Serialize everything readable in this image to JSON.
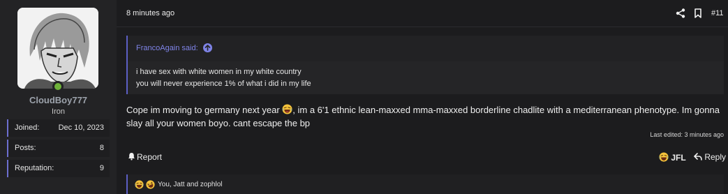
{
  "user": {
    "username": "CloudBoy777",
    "rank": "Iron",
    "status_color": "#6fb23a",
    "stats": [
      {
        "label": "Joined:",
        "value": "Dec 10, 2023"
      },
      {
        "label": "Posts:",
        "value": "8"
      },
      {
        "label": "Reputation:",
        "value": "9"
      }
    ]
  },
  "post": {
    "timestamp": "8 minutes ago",
    "number": "#11",
    "quote": {
      "author": "FrancoAgain said:",
      "lines": [
        "i have sex with white women in my white country",
        "you will never experience 1% of what i did in my life"
      ]
    },
    "body_before_emoji": "Cope im moving to germany next year ",
    "body_after_emoji": ", im a 6'1 ethnic lean-maxxed mma-maxxed borderline chadlite with a mediterranean phenotype. Im gonna slay all your women boyo. cant escape the bp",
    "body_emoji": "laughing-crying-emoji",
    "last_edited": "Last edited: 3 minutes ago"
  },
  "actions": {
    "report_label": "Report",
    "reaction_label": "JFL",
    "reply_label": "Reply"
  },
  "reactions": {
    "text": "You, Jatt and zophlol",
    "icons": [
      "laughing-crying-emoji",
      "rolling-laughing-emoji"
    ]
  },
  "colors": {
    "accent": "#6d6fd1",
    "link": "#7f84e8",
    "background": "#1c1c1e",
    "panel": "#232325"
  }
}
